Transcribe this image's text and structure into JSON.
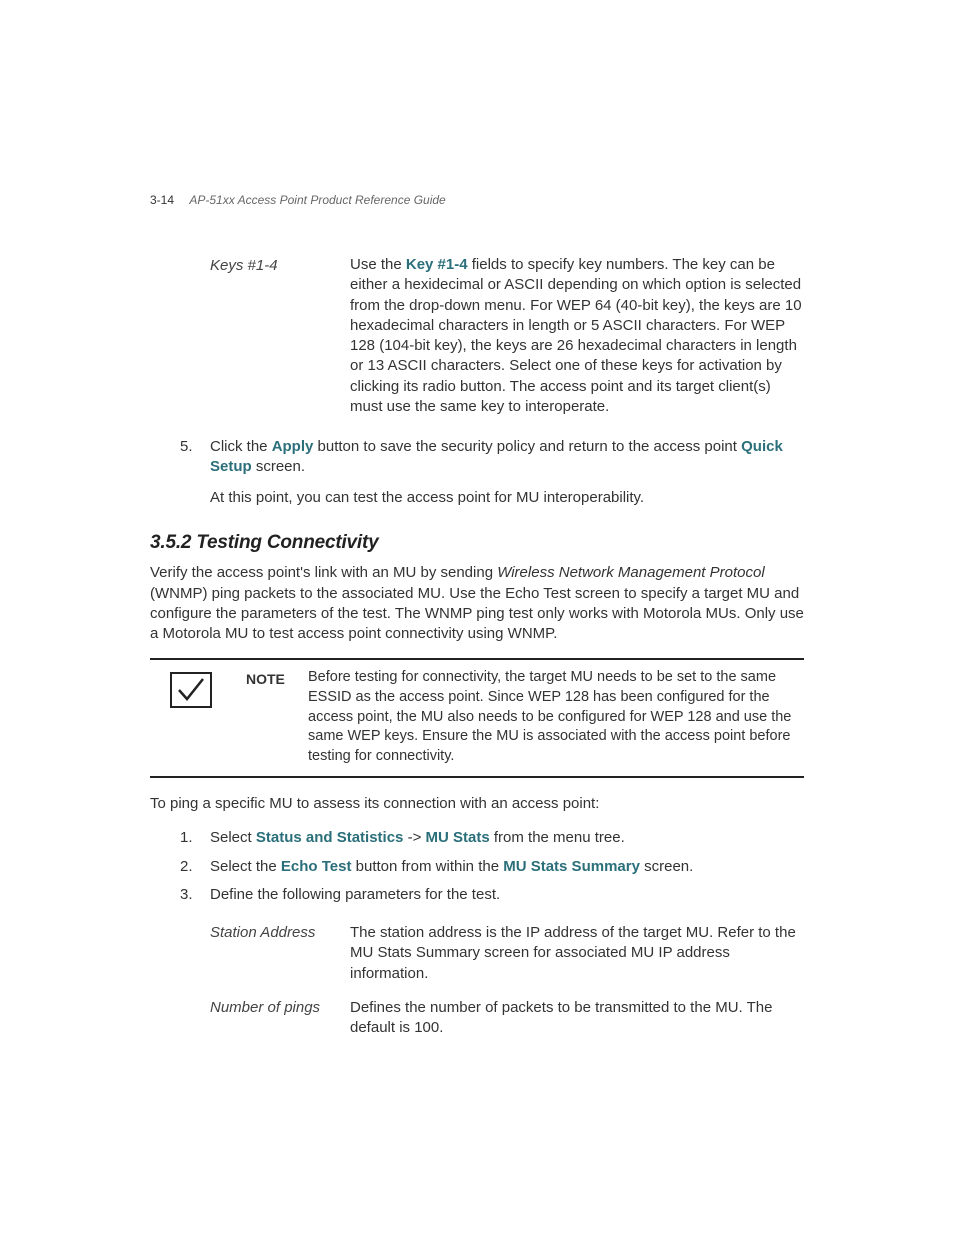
{
  "header": {
    "page_number": "3-14",
    "doc_title": "AP-51xx Access Point Product Reference Guide"
  },
  "keys_row": {
    "label": "Keys #1-4",
    "bold": "Key #1-4",
    "pre": "Use the ",
    "post": " fields to specify key numbers. The key can be either a hexidecimal or ASCII depending on which option is selected from the drop-down menu. For WEP 64 (40-bit key), the keys are 10 hexadecimal characters in length or 5 ASCII characters. For WEP 128 (104-bit key), the keys are 26 hexadecimal characters in length or 13 ASCII characters. Select one of these keys for activation by clicking its radio button. The access point and its target client(s) must use the same key to interoperate."
  },
  "step5": {
    "num": "5.",
    "t1": "Click the ",
    "b1": "Apply",
    "t2": " button to save the security policy and return to the access point ",
    "b2": "Quick Setup",
    "t3": " screen."
  },
  "step5b": "At this point, you can test the access point for MU interoperability.",
  "section_heading": "3.5.2 Testing Connectivity",
  "section_para": {
    "t1": "Verify the access point's link with an MU by sending ",
    "i1": "Wireless Network Management Protocol",
    "t2": " (WNMP) ping packets to the associated MU. Use the Echo Test screen to specify a target MU and configure the parameters of the test. The WNMP ping test only works with Motorola MUs. Only use a Motorola MU to test access point connectivity using WNMP."
  },
  "note": {
    "label": "NOTE",
    "text": "Before testing for connectivity, the target MU needs to be set to the same ESSID as the access point. Since WEP 128 has been configured for the access point, the MU also needs to be configured for WEP 128 and use the same WEP keys. Ensure the MU is associated with the access point before testing for connectivity."
  },
  "ping_intro": "To ping a specific MU to assess its connection with an access point:",
  "steps": {
    "s1": {
      "num": "1.",
      "t1": "Select ",
      "b1": "Status and Statistics",
      "t2": " -> ",
      "b2": "MU Stats",
      "t3": " from the menu tree."
    },
    "s2": {
      "num": "2.",
      "t1": "Select the ",
      "b1": "Echo Test",
      "t2": " button from within the ",
      "b2": "MU Stats Summary",
      "t3": " screen."
    },
    "s3": {
      "num": "3.",
      "t1": "Define the following parameters for the test."
    }
  },
  "params": {
    "p1": {
      "label": "Station Address",
      "desc": "The station address is the IP address of the target MU. Refer to the MU Stats Summary screen for associated MU IP address information."
    },
    "p2": {
      "label": "Number of pings",
      "desc": "Defines the number of packets to be transmitted to the MU. The default is 100."
    }
  }
}
